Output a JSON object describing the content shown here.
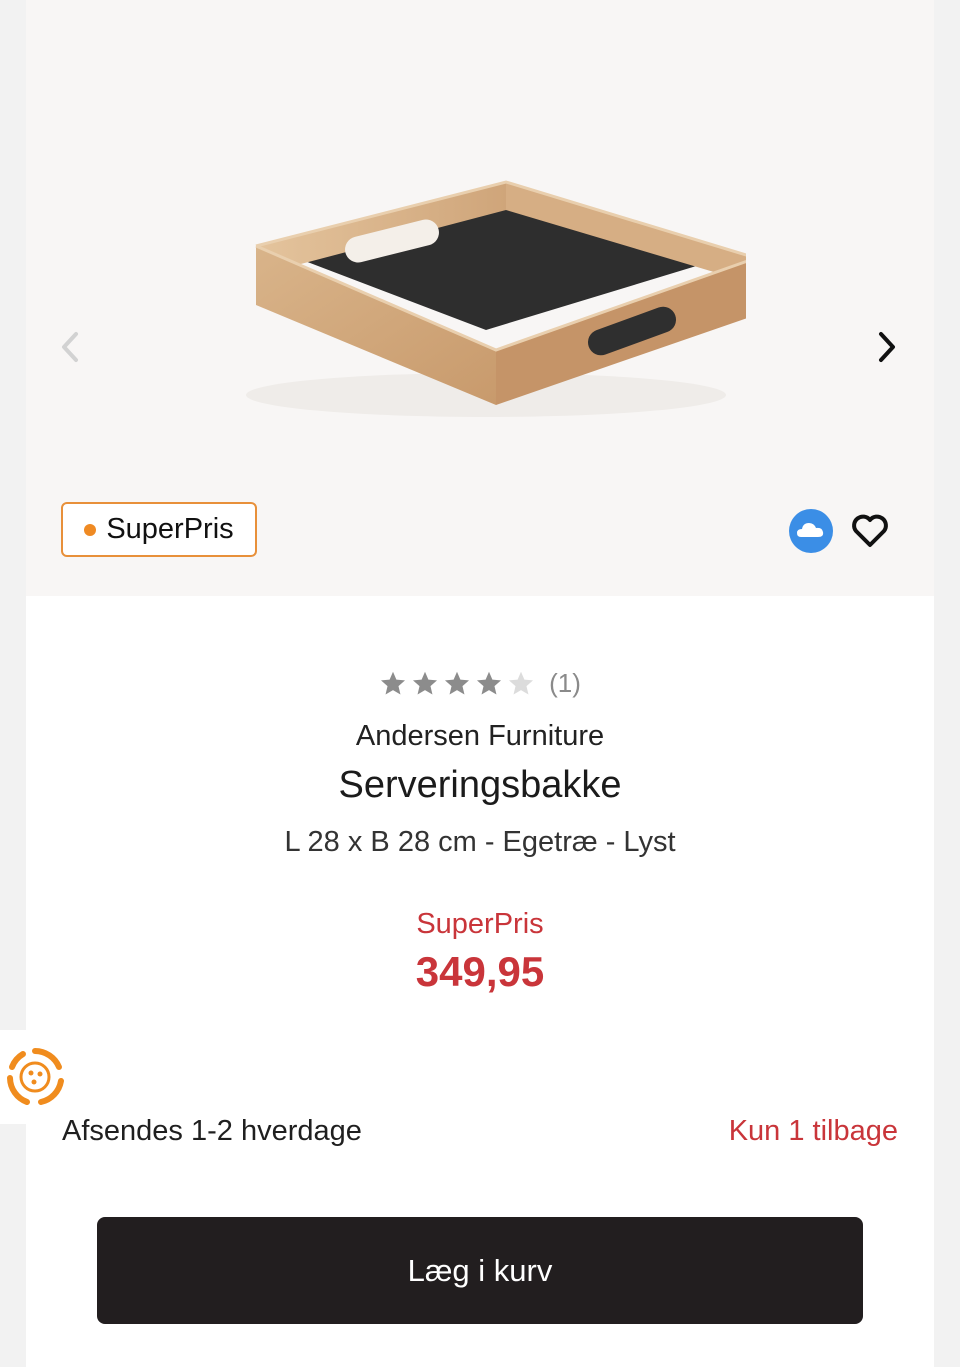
{
  "gallery": {
    "prev_icon": "chevron-left-icon",
    "next_icon": "chevron-right-icon",
    "badge": {
      "label": "SuperPris",
      "dot_color": "#ef8a23",
      "border_color": "#e8903a"
    },
    "actions": {
      "cloud_icon": "cloud-icon",
      "favorite_icon": "heart-icon"
    }
  },
  "product": {
    "rating": {
      "value": 4,
      "max": 5,
      "review_count": "(1)"
    },
    "brand": "Andersen Furniture",
    "title": "Serveringsbakke",
    "subtitle": "L 28 x B 28 cm - Egetræ - Lyst",
    "price_label": "SuperPris",
    "price": "349,95",
    "price_color": "#c9353a"
  },
  "delivery": {
    "shipping": "Afsendes 1-2 hverdage",
    "stock": "Kun 1 tilbage"
  },
  "cta": {
    "add_to_cart": "Læg i kurv"
  },
  "side_widget": {
    "icon": "settings-widget-icon"
  }
}
